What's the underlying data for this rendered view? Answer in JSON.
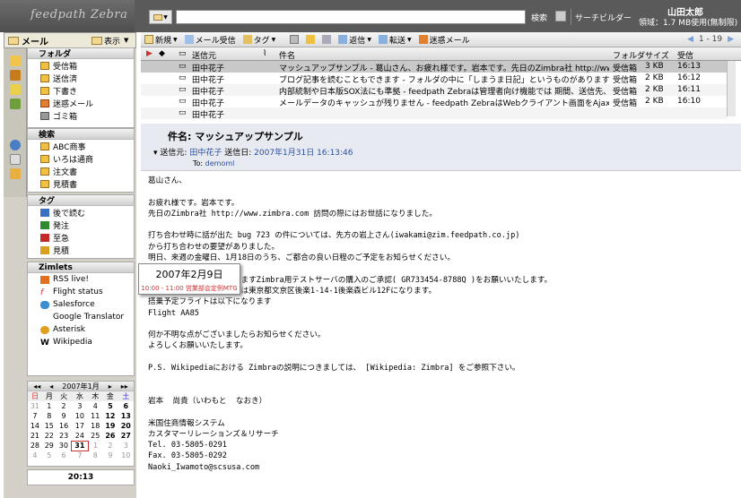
{
  "app": {
    "logo": "feedpath Zebra"
  },
  "search": {
    "button": "検索",
    "builder": "サーチビルダー",
    "type_icon": "mail-icon"
  },
  "user": {
    "name": "山田太郎",
    "quota": "領域：1.7 MB使用(無制限)"
  },
  "appbar": {
    "mail_label": "メール",
    "view_label": "表示"
  },
  "folders": {
    "header": "フォルダ",
    "items": [
      {
        "label": "受信箱",
        "icon": "inbox-icon"
      },
      {
        "label": "送信済",
        "icon": "sent-icon"
      },
      {
        "label": "下書き",
        "icon": "drafts-icon"
      },
      {
        "label": "迷惑メール",
        "icon": "junk-icon"
      },
      {
        "label": "ゴミ箱",
        "icon": "trash-icon"
      }
    ]
  },
  "searches": {
    "header": "検索",
    "items": [
      {
        "label": "ABC商事"
      },
      {
        "label": "いろは通商"
      },
      {
        "label": "注文書"
      },
      {
        "label": "見積書"
      }
    ]
  },
  "tags": {
    "header": "タグ",
    "items": [
      {
        "label": "後で読む",
        "color": "#3a6fc4"
      },
      {
        "label": "発注",
        "color": "#2e8b2e"
      },
      {
        "label": "至急",
        "color": "#c42a2a"
      },
      {
        "label": "見積",
        "color": "#d8a020"
      }
    ]
  },
  "zimlets": {
    "header": "Zimlets",
    "items": [
      {
        "label": "RSS live!"
      },
      {
        "label": "Flight status"
      },
      {
        "label": "Salesforce"
      },
      {
        "label": "Google Translator"
      },
      {
        "label": "Asterisk"
      },
      {
        "label": "Wikipedia"
      }
    ]
  },
  "calendar": {
    "title": "2007年1月",
    "weekdays": [
      "日",
      "月",
      "火",
      "水",
      "木",
      "金",
      "土"
    ],
    "weeks": [
      [
        "31",
        "1",
        "2",
        "3",
        "4",
        "5",
        "6"
      ],
      [
        "7",
        "8",
        "9",
        "10",
        "11",
        "12",
        "13"
      ],
      [
        "14",
        "15",
        "16",
        "17",
        "18",
        "19",
        "20"
      ],
      [
        "21",
        "22",
        "23",
        "24",
        "25",
        "26",
        "27"
      ],
      [
        "28",
        "29",
        "30",
        "31",
        "1",
        "2",
        "3"
      ],
      [
        "4",
        "5",
        "6",
        "7",
        "8",
        "9",
        "10"
      ]
    ]
  },
  "clock": "20:13",
  "toolbar": {
    "new": "新規",
    "receive": "メール受信",
    "tag": "タグ",
    "reply": "返信",
    "forward": "転送",
    "junk": "迷惑メール",
    "page": "1 - 19"
  },
  "list": {
    "headers": {
      "from": "送信元",
      "subject": "件名",
      "folder": "フォルダ",
      "size": "サイズ",
      "date": "受信"
    },
    "rows": [
      {
        "from": "田中花子",
        "subject": "マッシュアップサンプル - 葛山さん、お疲れ様です。岩本です。先日のZimbra社 http://www.zimbra.com 訪問の際",
        "folder": "受信箱",
        "size": "3 KB",
        "date": "16:13"
      },
      {
        "from": "田中花子",
        "subject": "ブログ記事を読むこともできます - フォルダの中に「しまうま日記」というものがありますが、これはRSSフィードになってま",
        "folder": "受信箱",
        "size": "2 KB",
        "date": "16:12"
      },
      {
        "from": "田中花子",
        "subject": "内部統制や日本版SOX法にも準拠 - feedpath Zebraは管理者向け機能では 期間、送信先、送信元などの情報",
        "folder": "受信箱",
        "size": "2 KB",
        "date": "16:11"
      },
      {
        "from": "田中花子",
        "subject": "メールデータのキャッシュが残りません - feedpath ZebraはWebクライアント画面をAjaxで動的に生成するため、クラ",
        "folder": "受信箱",
        "size": "2 KB",
        "date": "16:10"
      },
      {
        "from": "田中花子",
        "subject": "",
        "folder": "",
        "size": "",
        "date": ""
      }
    ]
  },
  "message": {
    "subject_label": "件名:",
    "subject": "マッシュアップサンプル",
    "from_label": "送信元:",
    "from": "田中花子",
    "date_label": "送信日:",
    "date": "2007年1月31日 16:13:46",
    "to_label": "To:",
    "to": "demoml",
    "lines": [
      "葛山さん、",
      "",
      "お疲れ様です。岩本です。",
      "先日のZimbra社 http://www.zimbra.com 訪問の際にはお世話になりました。",
      "",
      "打ち合わせ時に話が出た bug 723 の件については、先方の岩上さん(iwakami@zim.feedpath.co.jp)",
      "から打ち合わせの要望がありました。",
      "明日、来週の金曜日、1月18日のうち、ご都合の良い日程のご予定をお知らせください。",
      "",
      "                    ますZimbra用テストサーバの購入のご承認( GR733454-8788Q )をお願いいたします。",
      "                    は東京都文京区後楽1-14-1後楽森ビル12Fになります。",
      "搭乗予定フライトは以下になります",
      "Flight AA85",
      "",
      "何か不明な点がございましたらお知らせください。",
      "よろしくお願いいたします。",
      "",
      "P.S. Wikipediaにおける Zimbraの説明につきましては、 [Wikipedia: Zimbra] をご参照下さい。",
      "",
      "",
      "岩本  尚貴（いわもと  なおき）",
      "",
      "米国住商情報システム",
      "カスタマーリレーションズ＆リサーチ",
      "Tel. 03-5805-0291",
      "Fax. 03-5805-0292",
      "Naoki_Iwamoto@scsusa.com"
    ]
  },
  "popup": {
    "date": "2007年2月9日",
    "event": "10:00 - 11:00 営業部会定例MTG"
  }
}
